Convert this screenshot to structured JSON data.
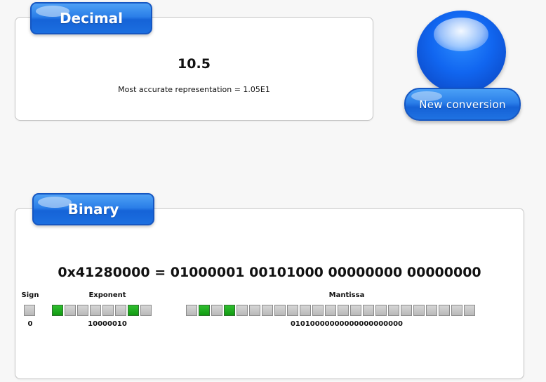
{
  "decimal": {
    "header": "Decimal",
    "value": "10.5",
    "accurate_text": "Most accurate representation = 1.05E1"
  },
  "new_conversion": {
    "label": "New conversion"
  },
  "binary": {
    "header": "Binary",
    "hex_equation": "0x41280000 = 01000001 00101000 00000000 00000000",
    "sign": {
      "label": "Sign",
      "bits": "0",
      "value": "0"
    },
    "exponent": {
      "label": "Exponent",
      "bits": "10000010",
      "value": "10000010"
    },
    "mantissa": {
      "label": "Mantissa",
      "bits": "01010000000000000000000",
      "value": "01010000000000000000000"
    }
  },
  "colors": {
    "accent_blue": "#1c6fe0",
    "bit_on": "#129a12",
    "bit_off": "#bdbdbd"
  }
}
